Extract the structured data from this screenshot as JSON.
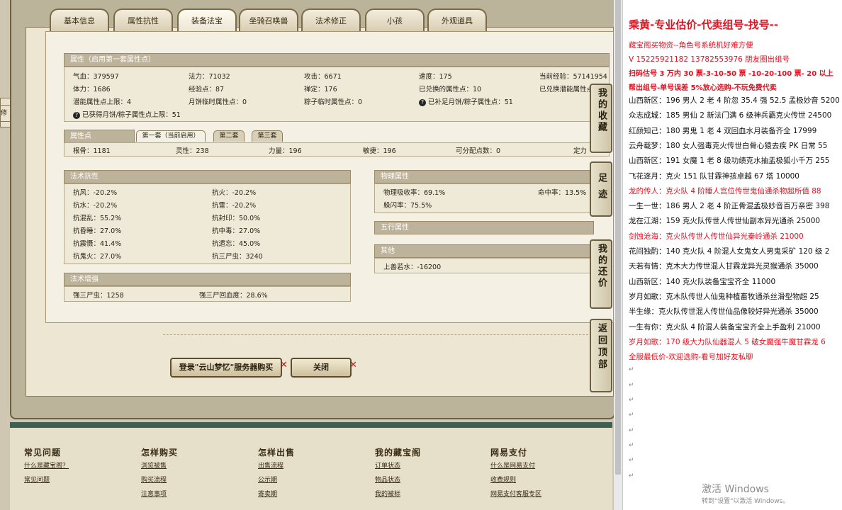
{
  "tabs": [
    "基本信息",
    "属性抗性",
    "装备法宝",
    "坐骑召唤兽",
    "法术修正",
    "小孩",
    "外观道具"
  ],
  "attr_panel": {
    "title": "属性（启用第一套属性点）",
    "rows": [
      [
        "气血：379597",
        "法力：71032",
        "攻击：6671",
        "速度：175",
        "当前经验：57141954"
      ],
      [
        "体力：1686",
        "经验点：87",
        "禅定：176",
        "已兑换的属性点：10",
        "已兑换潜能属性点"
      ],
      [
        "潜能属性点上限：4",
        "月饼临时属性点：0",
        "粽子临时属性点：0",
        "已补足月饼/粽子属性点：51",
        ""
      ]
    ],
    "note": "已获得月饼/粽子属性点上限：51"
  },
  "points_panel": {
    "title": "属性点",
    "subtabs": [
      "第一套（当前启用）",
      "第二套",
      "第三套"
    ],
    "row": [
      "根骨：1181",
      "灵性：238",
      "力量：196",
      "敏捷：196",
      "可分配点数：0",
      "定力"
    ]
  },
  "resist_panel": {
    "title": "法术抗性",
    "rows": [
      [
        "抗风：-20.2%",
        "抗火：-20.2%"
      ],
      [
        "抗水：-20.2%",
        "抗雷：-20.2%"
      ],
      [
        "抗混乱：55.2%",
        "抗封印：50.0%"
      ],
      [
        "抗昏睡：27.0%",
        "抗中毒：27.0%"
      ],
      [
        "抗震慑：41.4%",
        "抗遗忘：45.0%"
      ],
      [
        "抗鬼火：27.0%",
        "抗三尸虫：3240"
      ]
    ]
  },
  "enhance_panel": {
    "title": "法术增强",
    "row": [
      "强三尸虫：1258",
      "强三尸回血度：28.6%"
    ]
  },
  "physical_panel": {
    "title": "物理属性",
    "rows": [
      [
        "物理吸收率：69.1%",
        "命中率：13.5%"
      ],
      [
        "躲闪率：75.5%",
        ""
      ]
    ]
  },
  "five_panel": {
    "title": "五行属性"
  },
  "other_panel": {
    "title": "其他",
    "row": "上善若水：-16200"
  },
  "side_buttons": [
    "我的收藏",
    "足迹",
    "我的还价",
    "返回顶部"
  ],
  "buttons": {
    "login": "登录\"云山梦忆\"服务器购买",
    "close": "关闭"
  },
  "footer": [
    {
      "head": "常见问题",
      "links": [
        "什么是藏宝阁？",
        "常见问题"
      ]
    },
    {
      "head": "怎样购买",
      "links": [
        "浏览被售",
        "购买流程",
        "注意事项"
      ]
    },
    {
      "head": "怎样出售",
      "links": [
        "出售流程",
        "公示期",
        "寄卖期"
      ]
    },
    {
      "head": "我的藏宝阁",
      "links": [
        "订单状态",
        "物品状态",
        "我的被标"
      ]
    },
    {
      "head": "网易支付",
      "links": [
        "什么是网易支付",
        "收费规则",
        "网易支付客服专区"
      ]
    }
  ],
  "left_edge_text": "修正",
  "doc": {
    "lines": [
      {
        "t": "乘黄-专业估价-代卖组号-找号--",
        "c": "red",
        "big": true
      },
      {
        "t": "藏宝阁买物资--角色号系统机好难方便",
        "c": "red"
      },
      {
        "t": "V 15225921182   13782553976 朋友圈出组号",
        "c": "red"
      },
      {
        "t": "扫码估号 3 万内 30 票-3-10-50 票  -10-20-100 票- 20 以上",
        "c": "red"
      },
      {
        "t": "帮出组号-单号误差 5%放心选购-不玩免费代卖",
        "c": "red"
      },
      {
        "t": "山西新区：196 男人 2 老 4 阶忽 35.4 强 52.5 孟极妙音 5200",
        "c": ""
      },
      {
        "t": "众志成城：185 男仙 2 新法门满 6 级神兵霸克火传世 24500",
        "c": ""
      },
      {
        "t": "红颜知己：180 男鬼 1 老 4 双回血水月装备齐全 17999",
        "c": ""
      },
      {
        "t": "云舟载梦：180 女人强毒克火传世白骨心猿去疾 PK 日常 55",
        "c": ""
      },
      {
        "t": "山西新区：191 女魔 1 老 8 级功绩克水抽盂极狐小千万 255",
        "c": ""
      },
      {
        "t": "飞花逐月：克火 151 队甘霖神孩卓越 67 塔 10000",
        "c": ""
      },
      {
        "t": "龙的传人：克火队 4 阶睡人宫位传世鬼仙通杀物超所值 88",
        "c": "red"
      },
      {
        "t": "一生一世：186 男人 2 老 4 阶正骨混孟极妙音百万亲密 398",
        "c": ""
      },
      {
        "t": "龙在江湖：159 克火队传世人传世仙副本异光通杀 25000",
        "c": ""
      },
      {
        "t": "剑蚀沧海：克火队传世人传世仙异光秦岭通杀 21000",
        "c": "red"
      },
      {
        "t": "花间独酌：140 克火队 4 阶混人女鬼女人男鬼采矿 120 级 2",
        "c": ""
      },
      {
        "t": "天若有情：克木大力传世混人甘霖龙异光灵猴通杀 35000",
        "c": ""
      },
      {
        "t": "山西新区：140 克火队装备宝宝齐全 11000",
        "c": ""
      },
      {
        "t": "岁月如歌：克木队传世人仙鬼种植畜牧通杀丝滑型物超 25",
        "c": ""
      },
      {
        "t": "半生缘：克火队传世混人传世仙品像较好异光通杀 35000",
        "c": ""
      },
      {
        "t": "一生有你：克火队 4 阶混人装备宝宝齐全上手盈利 21000",
        "c": ""
      },
      {
        "t": "岁月如歌：170 级大力队仙器混人 5 破女魔强牛魔甘霖龙 6",
        "c": "red"
      },
      {
        "t": "全服最低价-欢迎选购-看号加好友私聊",
        "c": "red"
      }
    ],
    "para_mark": "↵",
    "activate_title": "激活 Windows",
    "activate_sub": "转到\"设置\"以激活 Windows。"
  },
  "colors": {
    "red": "#e3101f",
    "footer_bar": "#3f5f55",
    "panel_head": "#bdb29a"
  }
}
